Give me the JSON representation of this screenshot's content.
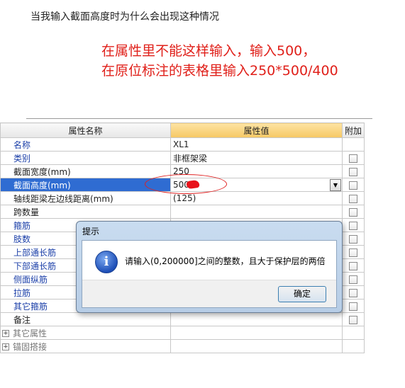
{
  "question": "当我输入截面高度时为什么会出现这种情况",
  "annotation": {
    "line1": "在属性里不能这样输入，输入500，",
    "line2": "在原位标注的表格里输入250*500/400"
  },
  "grid": {
    "headers": {
      "name": "属性名称",
      "value": "属性值",
      "add": "附加"
    },
    "rows": [
      {
        "name": "名称",
        "value": "XL1"
      },
      {
        "name": "类别",
        "value": "非框架梁"
      },
      {
        "name": "截面宽度(mm)",
        "value": "250"
      },
      {
        "name": "截面高度(mm)",
        "value": "500/"
      },
      {
        "name": "轴线距梁左边线距离(mm)",
        "value": "(125)"
      },
      {
        "name": "跨数量",
        "value": ""
      },
      {
        "name": "箍筋",
        "value": ""
      },
      {
        "name": "肢数",
        "value": ""
      },
      {
        "name": "上部通长筋",
        "value": ""
      },
      {
        "name": "下部通长筋",
        "value": ""
      },
      {
        "name": "侧面纵筋",
        "value": ""
      },
      {
        "name": "拉筋",
        "value": ""
      },
      {
        "name": "其它箍筋",
        "value": ""
      },
      {
        "name": "备注",
        "value": ""
      }
    ],
    "groups": [
      {
        "name": "其它属性"
      },
      {
        "name": "锚固搭接"
      }
    ],
    "colors": {
      "selected_row": "#2f6cd2",
      "value_header": "#f6c865",
      "blue_label": "#1b3fa8"
    }
  },
  "dialog": {
    "title": "提示",
    "message": "请输入(0,200000]之间的整数，且大于保护层的两倍",
    "ok_label": "确定",
    "icon": "info-icon"
  }
}
